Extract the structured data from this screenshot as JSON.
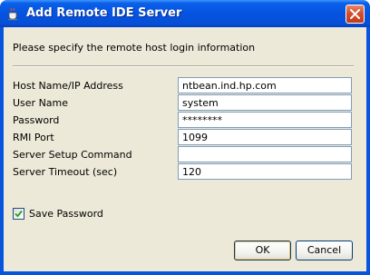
{
  "window": {
    "title": "Add Remote IDE Server",
    "icon": "java-cup-icon",
    "close_icon": "close-x-icon"
  },
  "instruction": "Please specify the remote host login information",
  "fields": [
    {
      "label": "Host Name/IP Address",
      "value": "ntbean.ind.hp.com",
      "type": "text"
    },
    {
      "label": "User Name",
      "value": "system",
      "type": "text"
    },
    {
      "label": "Password",
      "value": "********",
      "type": "password"
    },
    {
      "label": "RMI Port",
      "value": "1099",
      "type": "text"
    },
    {
      "label": "Server Setup Command",
      "value": "",
      "type": "text"
    },
    {
      "label": "Server Timeout (sec)",
      "value": "120",
      "type": "text"
    }
  ],
  "save_password": {
    "label": "Save Password",
    "checked": true
  },
  "buttons": {
    "ok": "OK",
    "cancel": "Cancel"
  },
  "colors": {
    "titlebar": "#0553e0",
    "dialog_bg": "#ece9d8",
    "close_button": "#d4502c",
    "input_border": "#7f9db9"
  }
}
